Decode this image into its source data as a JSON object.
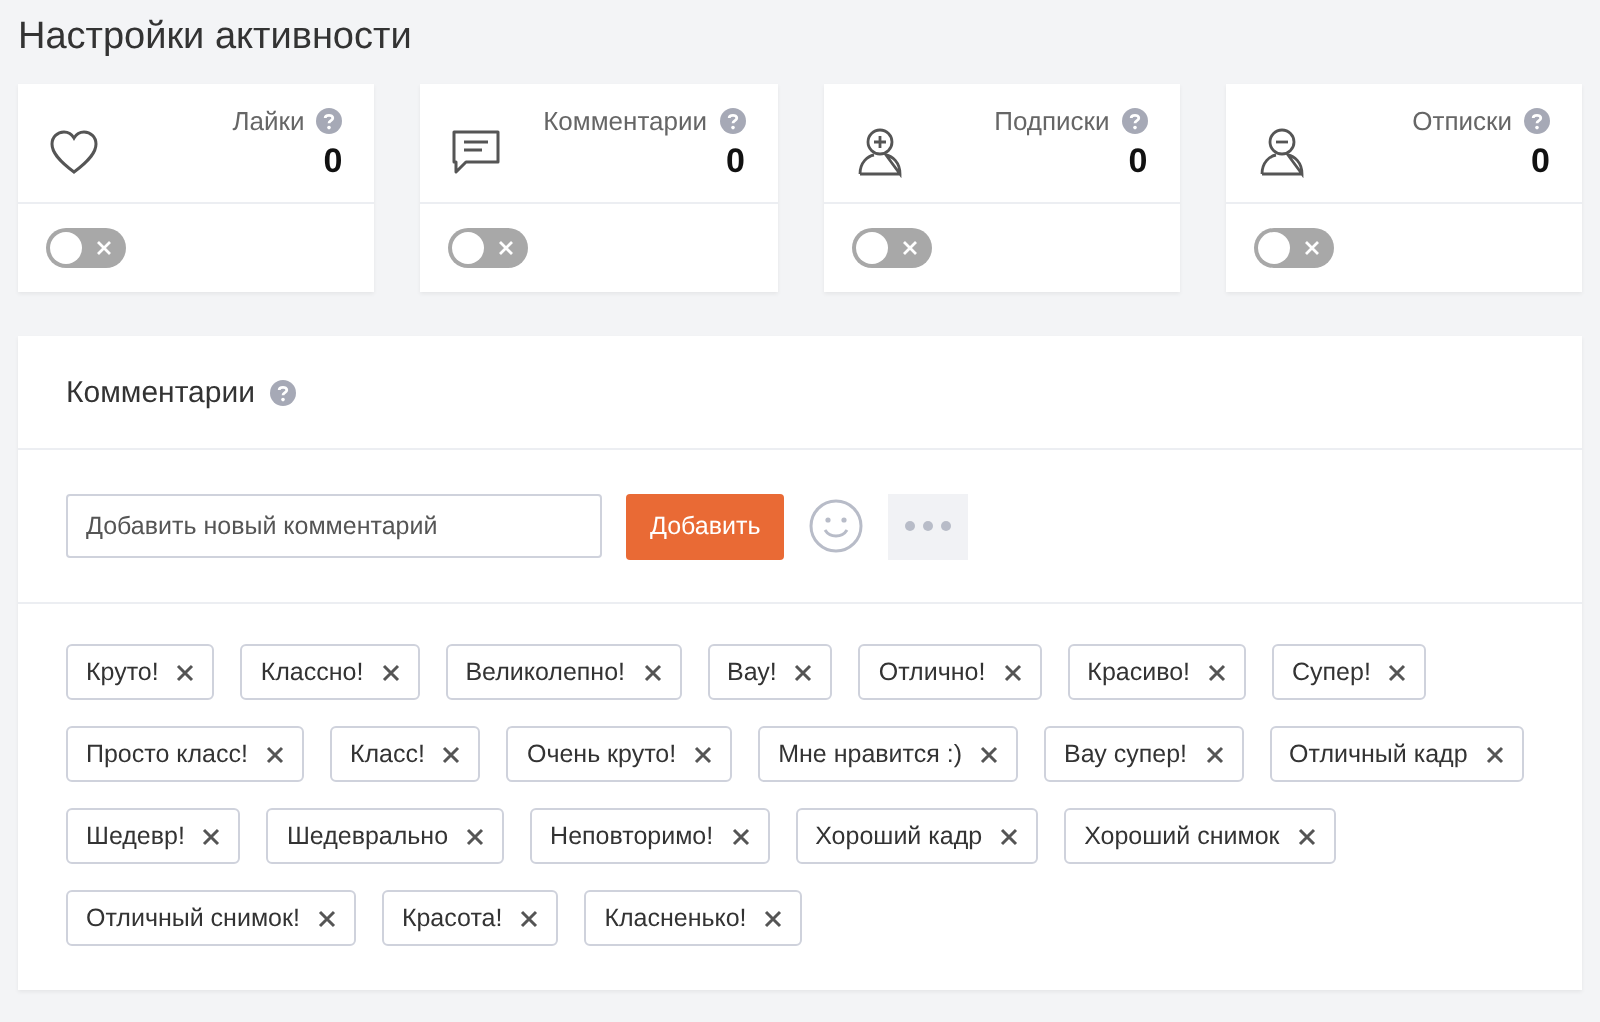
{
  "title": "Настройки активности",
  "stats": [
    {
      "kind": "likes",
      "label": "Лайки",
      "value": "0",
      "on": false
    },
    {
      "kind": "comments",
      "label": "Комментарии",
      "value": "0",
      "on": false
    },
    {
      "kind": "follows",
      "label": "Подписки",
      "value": "0",
      "on": false
    },
    {
      "kind": "unfollows",
      "label": "Отписки",
      "value": "0",
      "on": false
    }
  ],
  "comments": {
    "title": "Комментарии",
    "input": {
      "placeholder": "Добавить новый комментарий"
    },
    "add_button": "Добавить",
    "tags": [
      "Круто!",
      "Классно!",
      "Великолепно!",
      "Вау!",
      "Отлично!",
      "Красиво!",
      "Супер!",
      "Просто класс!",
      "Класс!",
      "Очень круто!",
      "Мне нравится :)",
      "Вау супер!",
      "Отличный кадр",
      "Шедевр!",
      "Шедеврально",
      "Неповторимо!",
      "Хороший кадр",
      "Хороший снимок",
      "Отличный снимок!",
      "Красота!",
      "Класненько!"
    ]
  }
}
